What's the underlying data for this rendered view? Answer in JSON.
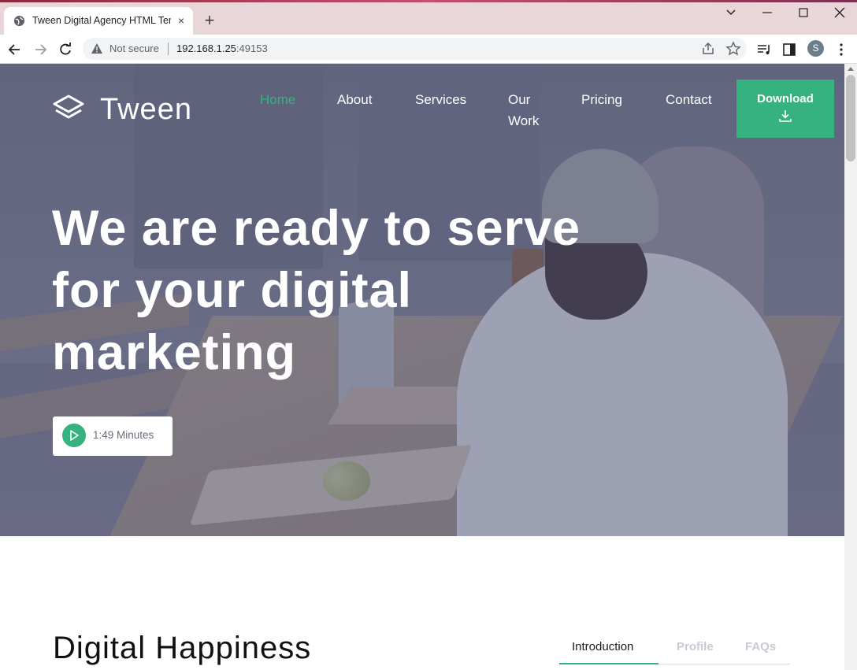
{
  "browser": {
    "tab_title": "Tween Digital Agency HTML Tem",
    "tab_close": "×",
    "new_tab": "+",
    "security_label": "Not secure",
    "url_host": "192.168.1.25",
    "url_port": ":49153",
    "profile_initial": "S"
  },
  "nav": {
    "logo_text": "Tween",
    "links": [
      "Home",
      "About",
      "Services",
      "Our Work",
      "Pricing",
      "Contact"
    ],
    "active_link": "Home",
    "download_label": "Download"
  },
  "hero": {
    "title": "We are ready to serve for your digital marketing",
    "video_label": "1:49 Minutes"
  },
  "section": {
    "title": "Digital Happiness",
    "tabs": [
      "Introduction",
      "Profile",
      "FAQs"
    ],
    "active_tab": "Introduction"
  },
  "colors": {
    "accent": "#35b27f",
    "hero_overlay": "#4e5270"
  }
}
